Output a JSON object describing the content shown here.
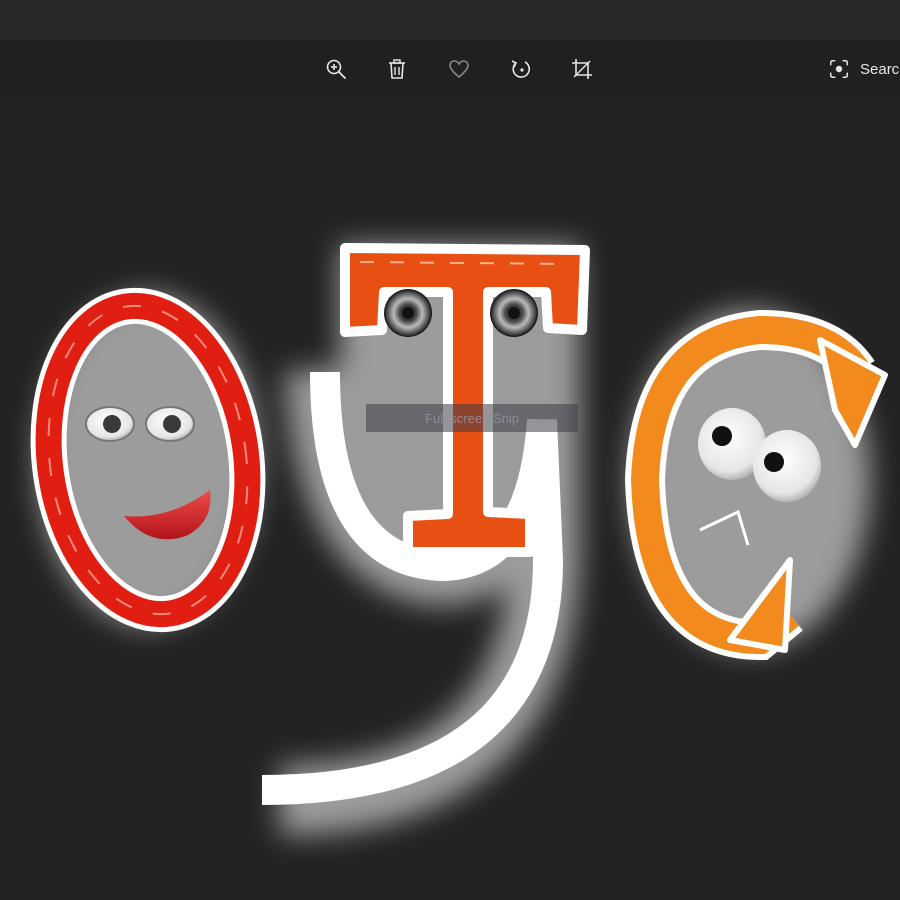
{
  "toolbar": {
    "zoom_icon": "zoom-in-icon",
    "delete_icon": "trash-icon",
    "favorite_icon": "heart-icon",
    "rotate_icon": "rotate-icon",
    "crop_icon": "crop-icon",
    "search_label": "Search",
    "search_icon": "visual-search-icon"
  },
  "overlay": {
    "snip_label": "Full-screen Snip"
  },
  "colors": {
    "background": "#232323",
    "toolbar": "#202020",
    "letter_o": "#e01f12",
    "letter_t": "#e84f12",
    "letter_c": "#f28a1e",
    "glow": "#ffffff"
  }
}
